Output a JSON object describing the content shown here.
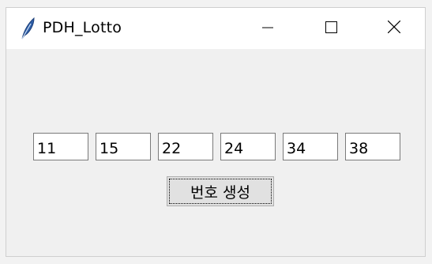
{
  "window": {
    "title": "PDH_Lotto",
    "icons": {
      "app": "feather-icon",
      "minimize": "minimize-icon",
      "maximize": "maximize-icon",
      "close": "close-icon"
    }
  },
  "numbers": [
    "11",
    "15",
    "22",
    "24",
    "34",
    "38"
  ],
  "generate_button": {
    "label": "번호 생성"
  }
}
